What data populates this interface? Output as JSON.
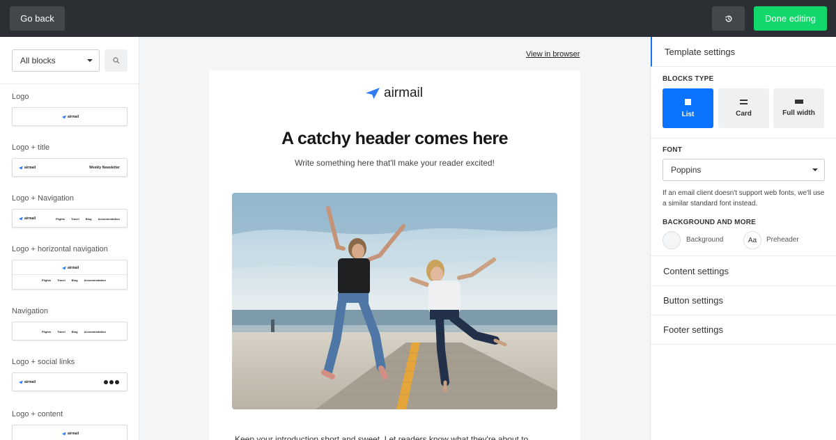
{
  "topbar": {
    "back_label": "Go back",
    "done_label": "Done editing"
  },
  "sidebar": {
    "filter": {
      "selected": "All blocks"
    },
    "blocks": [
      {
        "label": "Logo",
        "thumb": {
          "logo": "airmail"
        }
      },
      {
        "label": "Logo + title",
        "thumb": {
          "logo": "airmail",
          "title": "Weekly Newsletter"
        }
      },
      {
        "label": "Logo + Navigation",
        "thumb": {
          "logo": "airmail",
          "nav": [
            "Flights",
            "Travel",
            "Blog",
            "Accommodation"
          ]
        }
      },
      {
        "label": "Logo + horizontal navigation",
        "thumb": {
          "logo": "airmail",
          "nav": [
            "Flights",
            "Travel",
            "Blog",
            "Accommodation"
          ]
        }
      },
      {
        "label": "Navigation",
        "thumb": {
          "nav": [
            "Flights",
            "Travel",
            "Blog",
            "Accommodation"
          ]
        }
      },
      {
        "label": "Logo + social links",
        "thumb": {
          "logo": "airmail"
        }
      },
      {
        "label": "Logo + content",
        "thumb": {
          "logo": "airmail"
        }
      }
    ]
  },
  "canvas": {
    "view_in_browser": "View in browser",
    "email": {
      "logo_text": "airmail",
      "headline": "A catchy header comes here",
      "subline": "Write something here that'll make your reader excited!",
      "intro": "Keep your introduction short and sweet. Let readers know what they're about to"
    }
  },
  "panel": {
    "template_settings": "Template settings",
    "blocks_type_label": "BLOCKS TYPE",
    "block_types": [
      {
        "label": "List",
        "active": true
      },
      {
        "label": "Card",
        "active": false
      },
      {
        "label": "Full width",
        "active": false
      }
    ],
    "font_label": "FONT",
    "font_value": "Poppins",
    "font_note": "If an email client doesn't support web fonts, we'll use a similar standard font instead.",
    "background_label": "BACKGROUND AND MORE",
    "background_item": "Background",
    "preheader_item": "Preheader",
    "preheader_glyph": "Aa",
    "content_settings": "Content settings",
    "button_settings": "Button settings",
    "footer_settings": "Footer settings"
  },
  "colors": {
    "topbar": "#2b2f33",
    "done_button": "#12d86b",
    "accent_blue": "#0b73ff",
    "logo_blue": "#2f7cf6"
  }
}
